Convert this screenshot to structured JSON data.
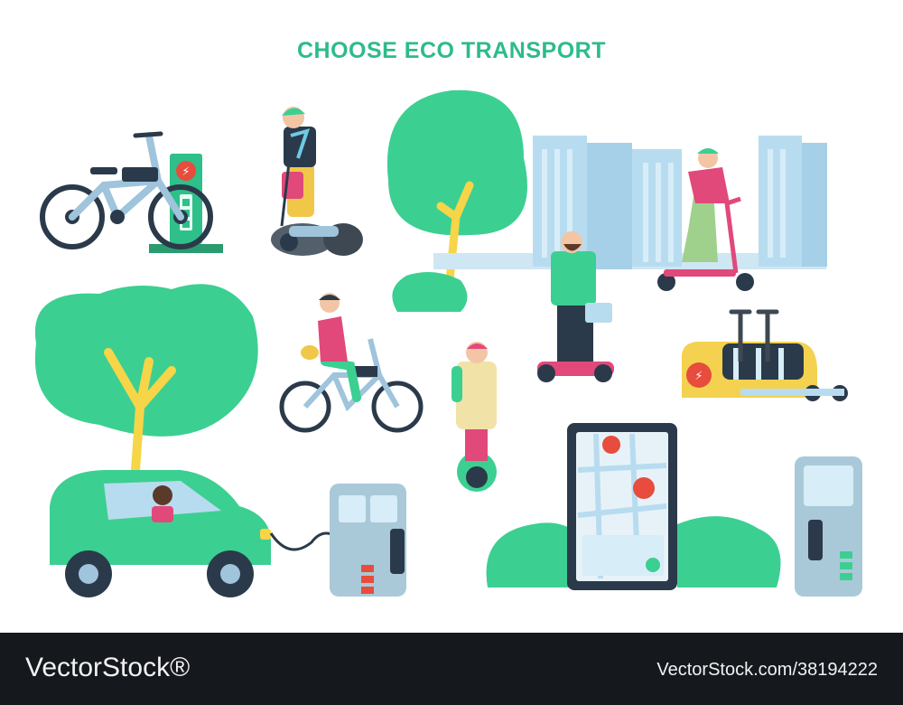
{
  "title": "CHOOSE ECO TRANSPORT",
  "footer": {
    "brand": "VectorStock",
    "registered_mark": "®",
    "stock_id": "VectorStock.com/38194222"
  },
  "palette": {
    "accent_green": "#2dbb8e",
    "tree_green": "#3ccf92",
    "building_blue": "#b8dcef",
    "charger_gray": "#a9c9d8",
    "footer_bg": "#15181d"
  }
}
